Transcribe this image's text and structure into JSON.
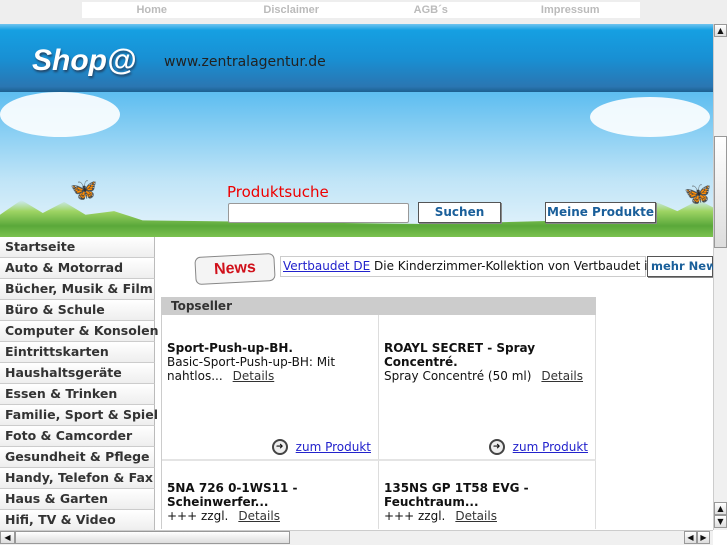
{
  "nav": [
    "Home",
    "Disclaimer",
    "AGB´s",
    "Impressum"
  ],
  "header": {
    "logo": "Shop@",
    "url": "www.zentralagentur.de"
  },
  "search": {
    "label": "Produktsuche",
    "value": "",
    "button": "Suchen",
    "my_products": "Meine Produkte"
  },
  "sidebar": {
    "items": [
      "Startseite",
      "Auto & Motorrad",
      "Bücher, Musik & Film",
      "Büro & Schule",
      "Computer & Konsolen",
      "Eintrittskarten",
      "Haushaltsgeräte",
      "Essen & Trinken",
      "Familie, Sport & Spiel",
      "Foto & Camcorder",
      "Gesundheit & Pflege",
      "Handy, Telefon & Fax",
      "Haus & Garten",
      "Hifi, TV & Video"
    ]
  },
  "news": {
    "badge": "News",
    "link": "Vertbaudet DE",
    "text": " Die Kinderzimmer-Kollektion von Vertbaudet is...",
    "more": "mehr News"
  },
  "topseller": {
    "title": "Topseller",
    "details": "Details",
    "to_product": "zum Produkt",
    "products": [
      {
        "title": "Sport-Push-up-BH.",
        "desc": "Basic-Sport-Push-up-BH: Mit nahtlos..."
      },
      {
        "title": "ROAYL SECRET - Spray Concentré.",
        "desc": "Spray Concentré (50 ml)"
      },
      {
        "title": "5NA 726 0-1WS11 - Scheinwerfer...",
        "desc": "+++ zzgl."
      },
      {
        "title": "135NS GP 1T58 EVG - Feuchtraum...",
        "desc": "+++ zzgl."
      }
    ]
  }
}
